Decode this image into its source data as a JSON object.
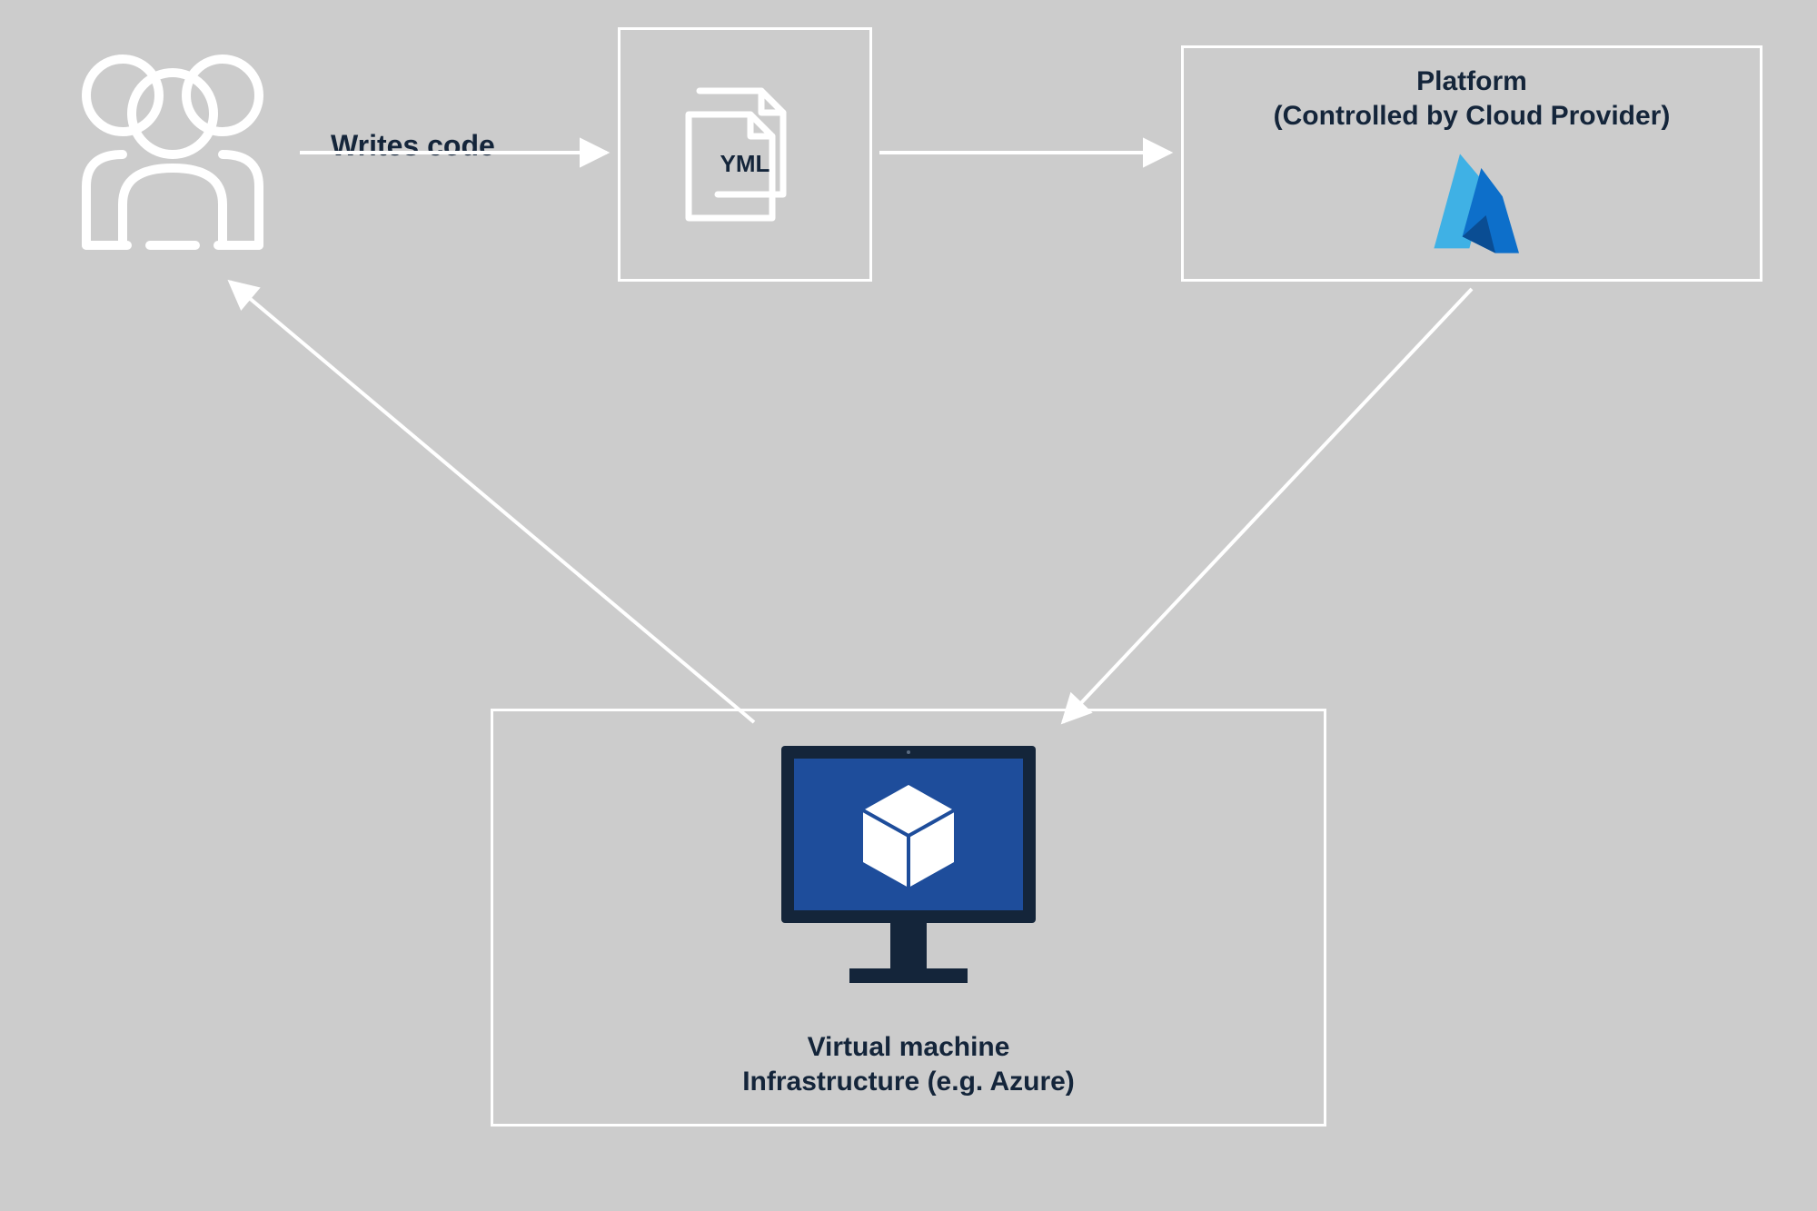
{
  "diagram": {
    "edge_writes_code_label": "Writes code",
    "yml_label": "YML",
    "platform_title_line1": "Platform",
    "platform_title_line2": "(Controlled by Cloud Provider)",
    "vm_label_line1": "Virtual machine",
    "vm_label_line2": "Infrastructure (e.g. Azure)",
    "colors": {
      "background": "#cccccc",
      "stroke": "#ffffff",
      "text": "#14253a",
      "vm_screen": "#1e4d9b",
      "vm_body": "#14253a",
      "azure_light": "#3fb1e5",
      "azure_dark": "#0d6fca"
    }
  }
}
